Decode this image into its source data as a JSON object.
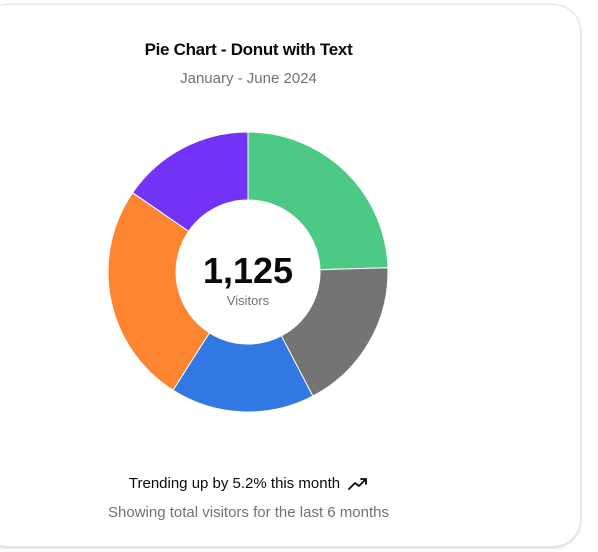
{
  "card": {
    "title": "Pie Chart - Donut with Text",
    "subtitle": "January - June 2024",
    "trend_text": "Trending up by 5.2% this month",
    "trend_icon": "trending-up-icon",
    "note": "Showing total visitors for the last 6 months"
  },
  "chart_data": {
    "type": "pie",
    "donut": true,
    "categories": [
      "Green",
      "Gray",
      "Blue",
      "Orange",
      "Purple"
    ],
    "values": [
      275,
      200,
      187,
      287,
      173
    ],
    "colors": [
      "#4bc985",
      "#747474",
      "#3278e2",
      "#fd8430",
      "#7233f7"
    ],
    "center_value": "1,125",
    "center_label": "Visitors",
    "title": "Pie Chart - Donut with Text",
    "subtitle": "January - June 2024"
  }
}
